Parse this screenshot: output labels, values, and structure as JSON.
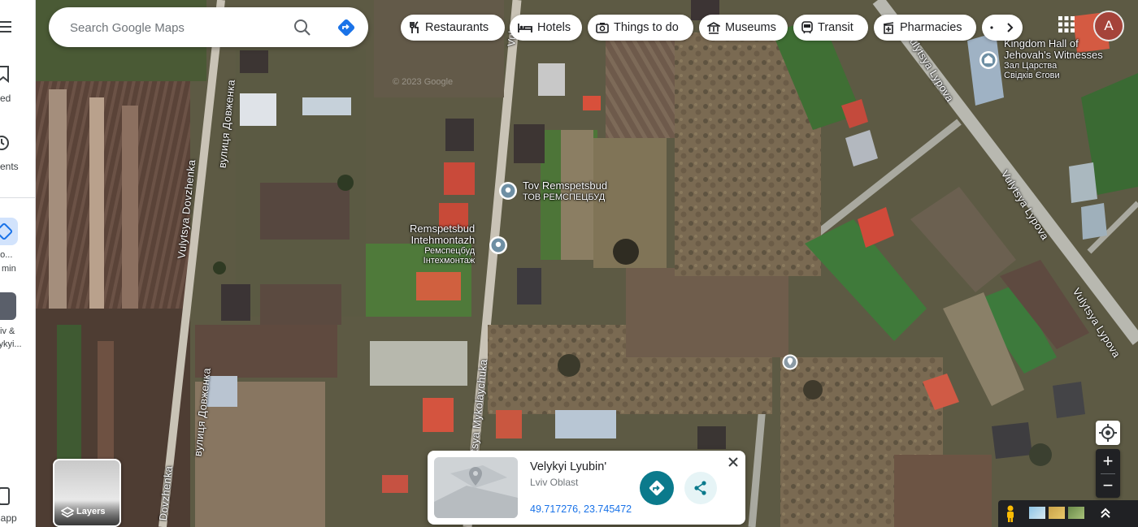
{
  "search": {
    "placeholder": "Search Google Maps",
    "search_icon": "search-icon",
    "directions_icon": "directions-icon"
  },
  "chips": [
    {
      "label": "Restaurants",
      "icon": "restaurant-icon"
    },
    {
      "label": "Hotels",
      "icon": "hotel-icon"
    },
    {
      "label": "Things to do",
      "icon": "camera-icon"
    },
    {
      "label": "Museums",
      "icon": "museum-icon"
    },
    {
      "label": "Transit",
      "icon": "transit-icon"
    },
    {
      "label": "Pharmacies",
      "icon": "pharmacy-icon"
    }
  ],
  "chip_more_icon": "chevron-right-icon",
  "account": {
    "initial": "A",
    "apps_icon": "apps-grid-icon"
  },
  "rail": {
    "menu_icon": "menu-icon",
    "saved_label": "ved",
    "recents_label": "cents",
    "recent_place_line1": "po...",
    "recent_place_line2": "min",
    "recent_place2_line1": "iv &",
    "recent_place2_line2": "lykyi...",
    "get_app_label": "t app"
  },
  "layers": {
    "label": "Layers"
  },
  "pois": [
    {
      "name": "Tov Remspetsbud",
      "alt": "ТОВ РЕМСПЕЦБУД"
    },
    {
      "name_line1": "Remspetsbud",
      "name_line2": "Intehmontazh",
      "alt_line1": "Ремспецбуд",
      "alt_line2": "Інтехмонтаж"
    },
    {
      "name_line1": "Kingdom Hall of",
      "name_line2": "Jehovah's Witnesses",
      "alt_line1": "Зал Царства",
      "alt_line2": "Свідків Єгови"
    }
  ],
  "streets": {
    "dovzhenka_en": "Vulytsya Dovzhenka",
    "dovzhenka_uk": "вулиця Довженка",
    "dovzhenka_bottom": "Dovzhenka",
    "mykolaychuka": "Vulytsya Mykolaychuka",
    "top_road": "Vul",
    "lypova_1": "Vulytsya Lypova",
    "lypova_2": "Vulytsya Lypova",
    "lypova_3": "Vulytsya Lypova"
  },
  "watermark": "© 2023 Google",
  "place_card": {
    "title": "Velykyi Lyubin'",
    "subtitle": "Lviv Oblast",
    "coords": "49.717276, 23.745472",
    "directions_icon": "directions-icon",
    "share_icon": "share-icon",
    "close_icon": "close-icon"
  },
  "controls": {
    "my_location_icon": "my-location-icon",
    "zoom_in": "+",
    "zoom_out": "−",
    "pegman_icon": "pegman-icon",
    "expand_icon": "chevrons-up-icon"
  }
}
